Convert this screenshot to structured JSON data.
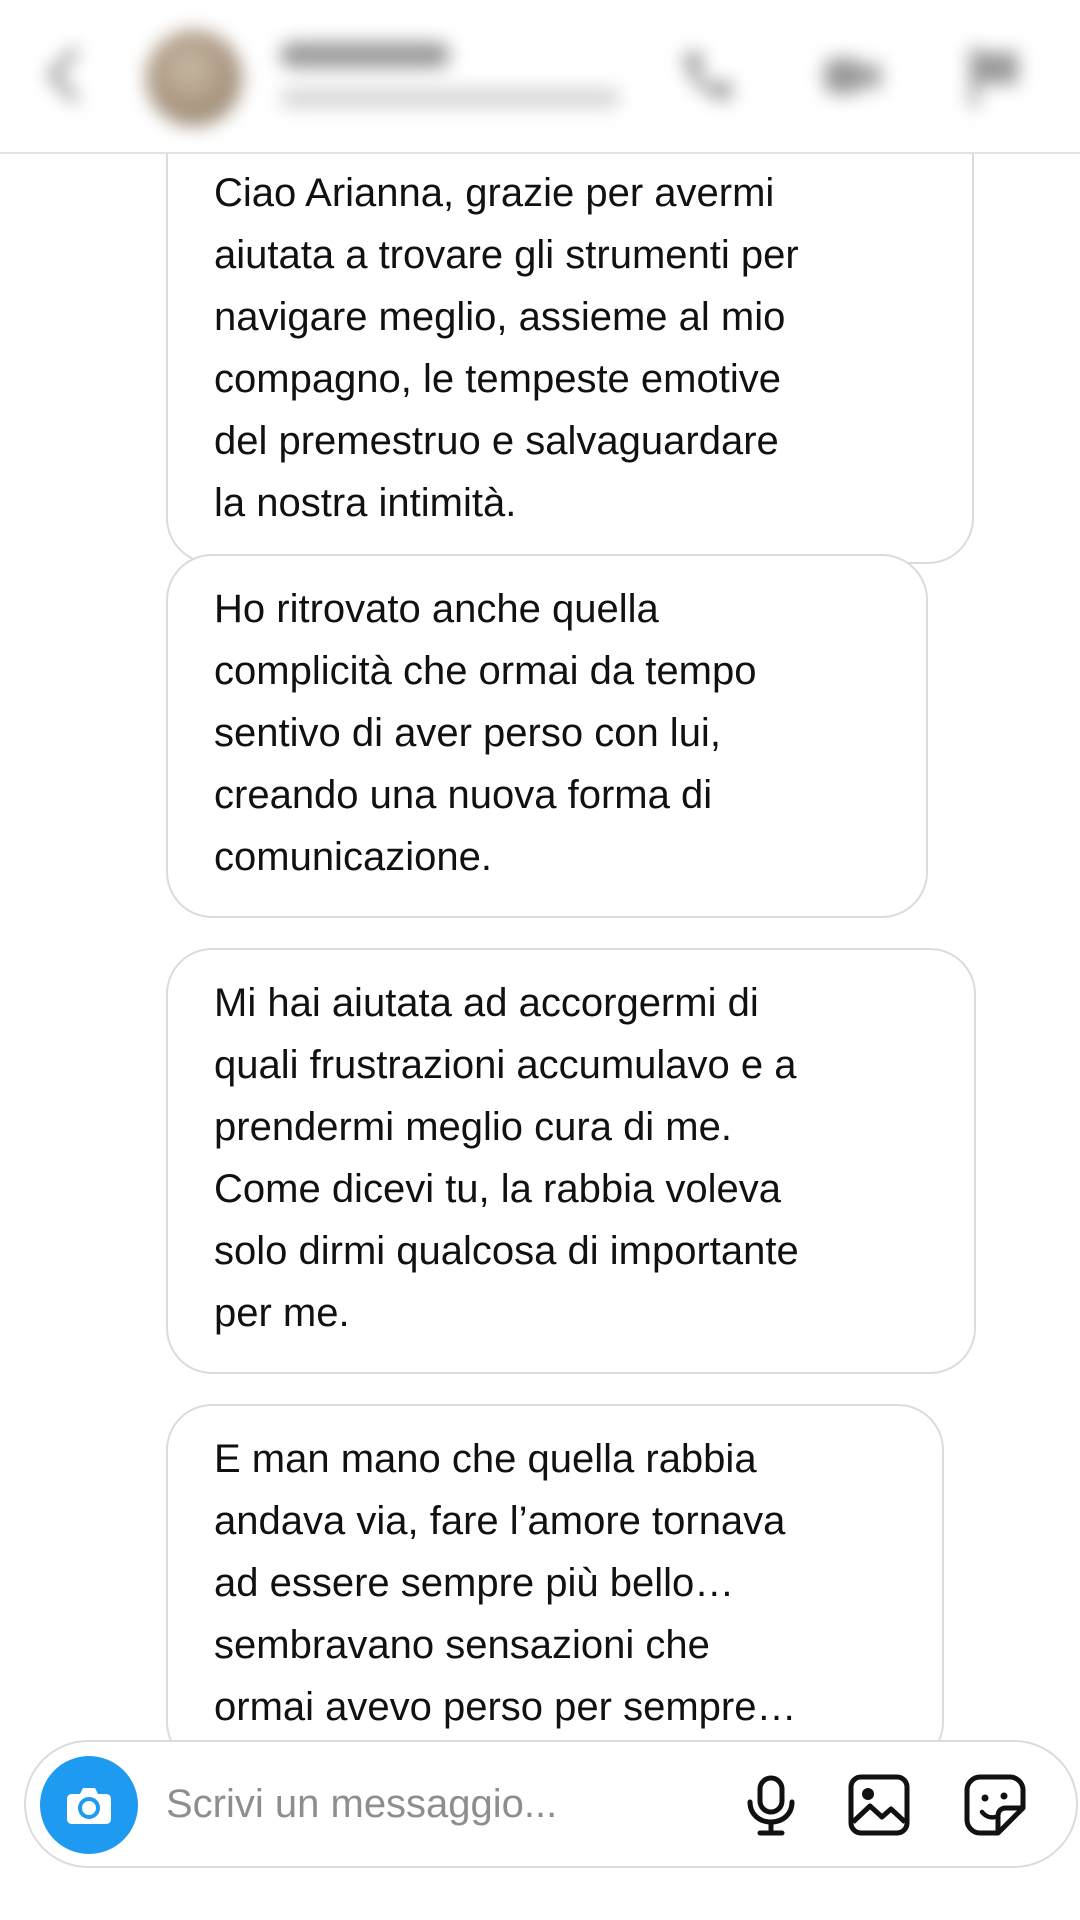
{
  "header": {
    "contact_name": "",
    "contact_status": "",
    "icons": [
      "chevron-left-icon",
      "avatar",
      "phone-icon",
      "video-icon",
      "flag-icon"
    ]
  },
  "messages": [
    {
      "text": "Ciao Arianna, grazie per avermi\naiutata a trovare gli strumenti per\nnavigare meglio, assieme al mio\ncompagno, le tempeste emotive\ndel premestruo e salvaguardare\nla nostra intimità."
    },
    {
      "text": "Ho ritrovato anche quella\ncomplicità che ormai da tempo\nsentivo di aver perso con lui,\ncreando una nuova forma di\ncomunicazione."
    },
    {
      "text": "Mi hai aiutata ad accorgermi di\nquali frustrazioni accumulavo e a\nprendermi meglio cura di me.\nCome dicevi tu, la rabbia voleva\nsolo dirmi qualcosa di importante\nper me."
    },
    {
      "text": "E man mano che quella rabbia\nandava via, fare l’amore tornava\nad essere sempre più bello…\nsembravano sensazioni che\normai avevo perso per sempre…"
    }
  ],
  "composer": {
    "placeholder": "Scrivi un messaggio...",
    "value": "",
    "icons": [
      "camera-icon",
      "microphone-icon",
      "image-icon",
      "sticker-icon"
    ]
  },
  "colors": {
    "accent": "#1e9bf0",
    "bubble_border": "#dbdbdb",
    "text": "#111111",
    "placeholder": "#8e8e8e"
  }
}
